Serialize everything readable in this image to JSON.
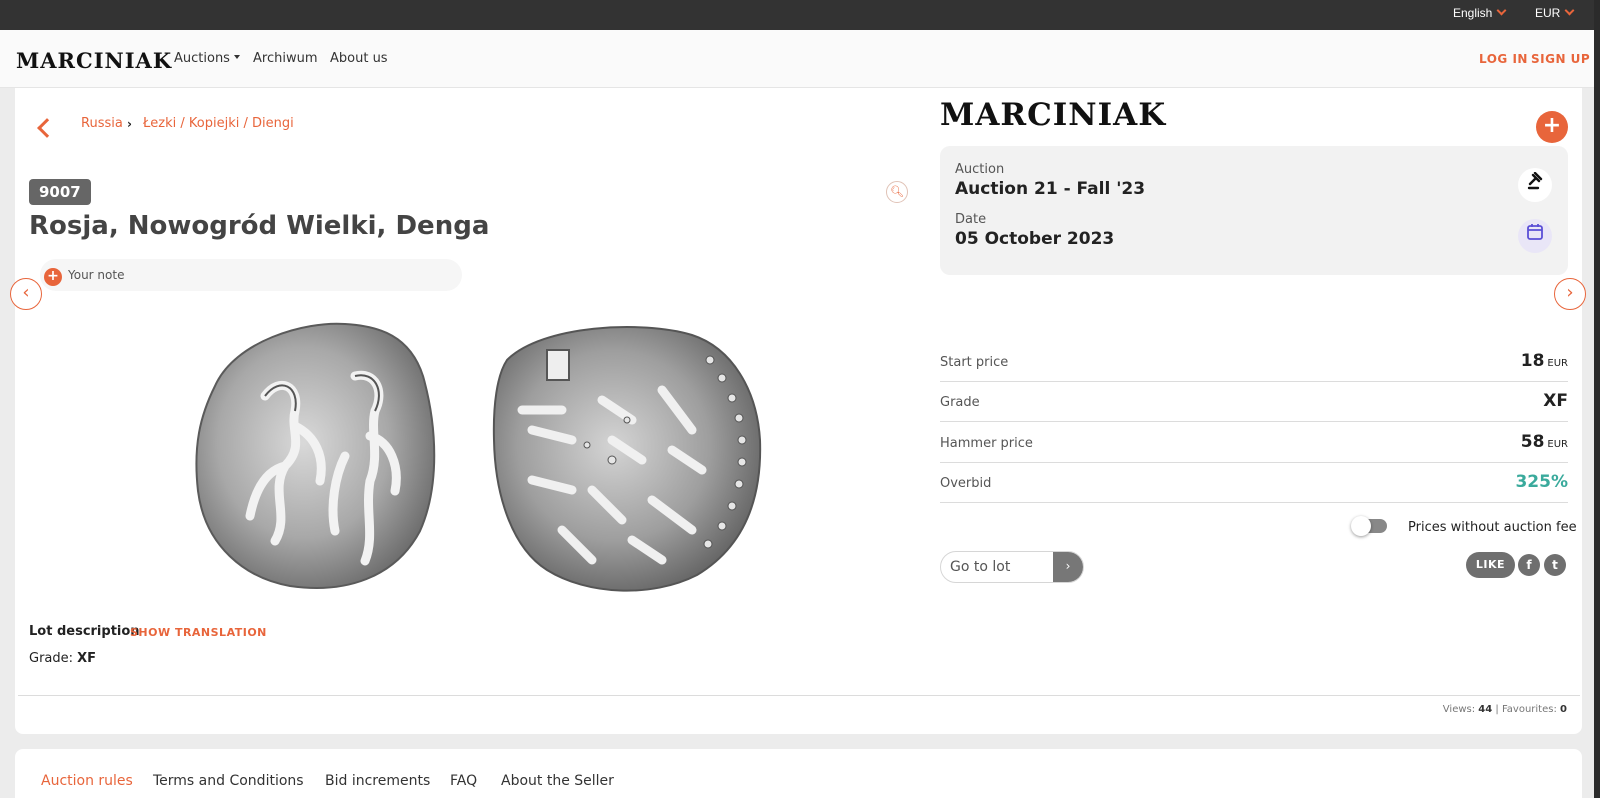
{
  "topbar": {
    "language": "English",
    "currency": "EUR"
  },
  "nav": {
    "logo": "MARCINIAK",
    "links": [
      "Auctions",
      "Archiwum",
      "About us"
    ],
    "login": "LOG IN",
    "signup": "SIGN UP"
  },
  "breadcrumb": [
    "Russia",
    "Łezki / Kopiejki / Diengi"
  ],
  "lot": {
    "number": "9007",
    "title": "Rosja, Nowogród Wielki, Denga",
    "note_placeholder": "Your note",
    "description_label": "Lot description",
    "show_translation": "SHOW TRANSLATION",
    "grade_label": "Grade:",
    "grade_value": "XF"
  },
  "auction": {
    "house_logo": "MARCINIAK",
    "auction_label": "Auction",
    "auction_value": "Auction 21 - Fall '23",
    "date_label": "Date",
    "date_value": "05 October 2023"
  },
  "prices": [
    {
      "label": "Start price",
      "value": "18",
      "unit": "EUR"
    },
    {
      "label": "Grade",
      "value": "XF",
      "unit": ""
    },
    {
      "label": "Hammer price",
      "value": "58",
      "unit": "EUR"
    },
    {
      "label": "Overbid",
      "value": "325%",
      "unit": ""
    }
  ],
  "colors": {
    "accent": "#e8653b",
    "overbid": "#3aaa9c"
  },
  "toggle_label": "Prices without auction fee",
  "goto": {
    "placeholder": "Go to lot",
    "button": "›"
  },
  "social": {
    "like": "LIKE",
    "facebook": "f",
    "twitter": "t"
  },
  "stats": {
    "views_label": "Views:",
    "views": "44",
    "fav_label": "| Favourites:",
    "favourites": "0"
  },
  "footer_tabs": [
    "Auction rules",
    "Terms and Conditions",
    "Bid increments",
    "FAQ",
    "About the Seller"
  ]
}
